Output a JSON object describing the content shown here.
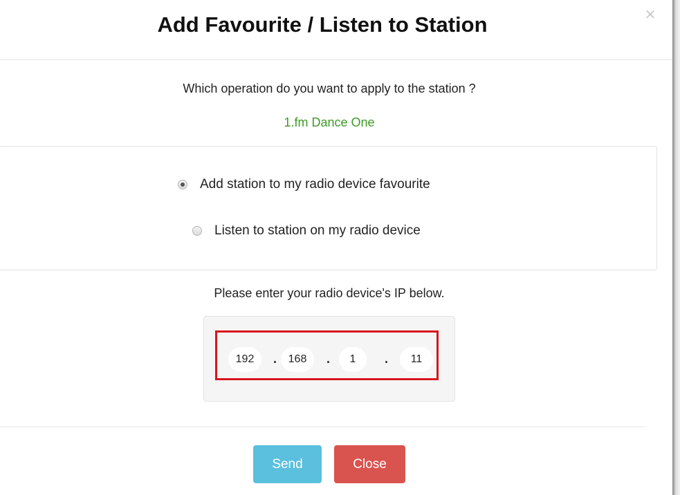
{
  "dialog": {
    "title": "Add Favourite / Listen to Station",
    "close_icon": "×"
  },
  "question": "Which operation do you want to apply to the station ?",
  "station_name": "1.fm Dance One",
  "options": [
    {
      "label": "Add station to my radio device favourite",
      "checked": true
    },
    {
      "label": "Listen to station on my radio device",
      "checked": false
    }
  ],
  "ip_prompt": "Please enter your radio device's IP below.",
  "ip": {
    "octets": [
      "192",
      "168",
      "1",
      "11"
    ],
    "separator": "."
  },
  "buttons": {
    "send": "Send",
    "close": "Close"
  },
  "colors": {
    "station_green": "#3d9a24",
    "send_button": "#5bc0de",
    "close_button": "#d9534f",
    "highlight_border": "#d7141d"
  }
}
